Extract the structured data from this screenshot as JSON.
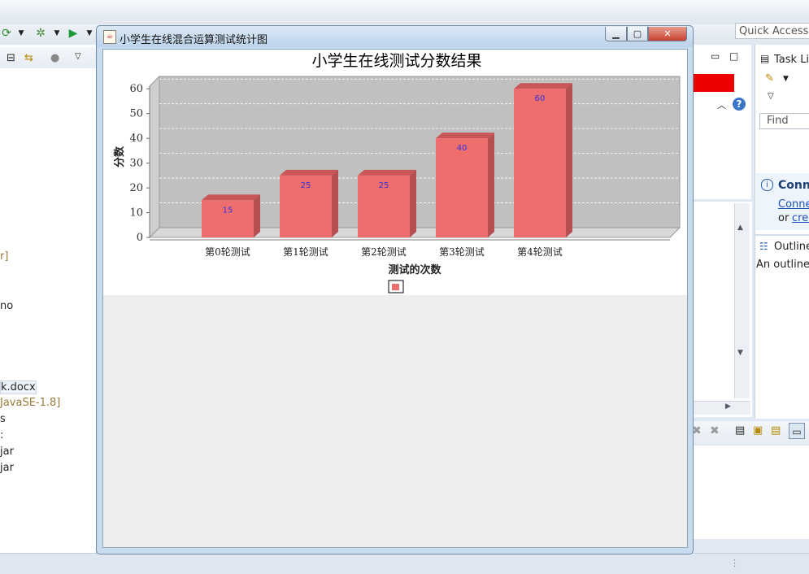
{
  "ide": {
    "quick_access": "Quick Access",
    "tree_items": [
      "r]",
      "no",
      "k.docx",
      "JavaSE-1.8]",
      "s",
      ":",
      "jar",
      "jar"
    ],
    "right_panel": {
      "task_list_label": "Task Lis",
      "find_placeholder": "Find",
      "connect_heading": "Conne",
      "connect_link": "Conne",
      "or_text": "or",
      "create_link": "crea",
      "outline_label": "Outline",
      "outline_text": "An outline i"
    },
    "colors": {
      "accent_red": "#ee0000"
    }
  },
  "window": {
    "title": "小学生在线混合运算测试统计图",
    "icon": "java-cup-icon",
    "minimize_icon": "minimize-icon",
    "maximize_icon": "maximize-icon",
    "close_icon": "close-icon"
  },
  "chart_data": {
    "type": "bar",
    "title": "小学生在线测试分数结果",
    "xlabel": "测试的次数",
    "ylabel": "分数",
    "categories": [
      "第0轮测试",
      "第1轮测试",
      "第2轮测试",
      "第3轮测试",
      "第4轮测试"
    ],
    "series": [
      {
        "values": [
          15,
          25,
          25,
          40,
          60
        ],
        "color": "#ee6e6e"
      }
    ],
    "ylim": [
      0,
      65
    ],
    "yticks": [
      0,
      10,
      20,
      30,
      40,
      50,
      60
    ],
    "grid": true,
    "style": "3d",
    "plot_background": "#c0c0c0",
    "label_color": "#3333dd",
    "legend": "bottom-center"
  }
}
